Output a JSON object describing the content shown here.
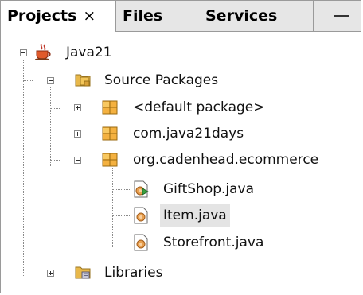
{
  "tabs": [
    {
      "label": "Projects",
      "close": "×"
    },
    {
      "label": "Files"
    },
    {
      "label": "Services"
    }
  ],
  "tree": {
    "project": "Java21",
    "source_packages": "Source Packages",
    "packages": [
      "<default package>",
      "com.java21days",
      "org.cadenhead.ecommerce"
    ],
    "files": [
      "GiftShop.java",
      "Item.java",
      "Storefront.java"
    ],
    "libraries": "Libraries",
    "selected": "Item.java"
  },
  "colors": {
    "folder": "#e8b84a",
    "package": "#f0a830",
    "java_file": "#c87a28",
    "selected_bg": "#e4e4e4"
  },
  "icons": [
    "java-cup-icon",
    "source-folder-icon",
    "package-icon",
    "java-class-icon",
    "java-main-class-icon",
    "library-folder-icon"
  ]
}
